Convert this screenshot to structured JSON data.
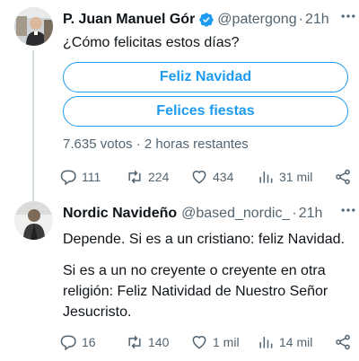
{
  "tweets": [
    {
      "name": "P. Juan Manuel Gór",
      "handle": "@patergong",
      "separator": "·",
      "time": "21h",
      "text": "¿Cómo felicitas estos días?",
      "poll": {
        "options": [
          "Feliz Navidad",
          "Felices fiestas"
        ],
        "votes": "7.635 votos",
        "remaining": "2 horas restantes"
      },
      "stats": {
        "replies": "111",
        "retweets": "224",
        "likes": "434",
        "views": "31 mil"
      }
    },
    {
      "name": "Nordic Navideño",
      "handle": "@based_nordic_",
      "separator": "·",
      "time": "21h",
      "text_lines": [
        "Depende. Si es a un cristiano: feliz Navidad.",
        "Si es a un no creyente o creyente en otra",
        "religión: Feliz Natividad de Nuestro Señor",
        "Jesucristo."
      ],
      "stats": {
        "replies": "16",
        "retweets": "140",
        "likes": "1 mil",
        "views": "14 mil"
      }
    }
  ],
  "colors": {
    "accent": "#1d9bf0",
    "muted": "#536471",
    "text": "#0f1419",
    "verified": "#1d9bf0"
  }
}
